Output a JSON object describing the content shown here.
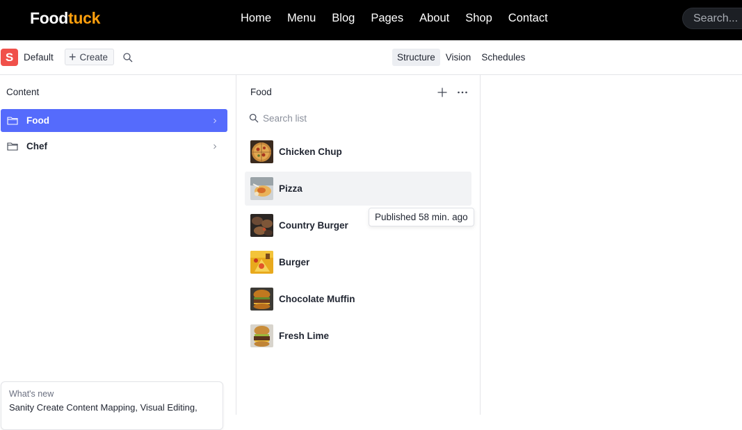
{
  "site": {
    "logo_part1": "Food",
    "logo_part2": "tuck",
    "nav": [
      "Home",
      "Menu",
      "Blog",
      "Pages",
      "About",
      "Shop",
      "Contact"
    ],
    "search_placeholder": "Search..."
  },
  "studio": {
    "workspace_initial": "S",
    "workspace_name": "Default",
    "create_label": "Create",
    "tools": [
      "Structure",
      "Vision",
      "Schedules"
    ],
    "active_tool": "Structure"
  },
  "content_pane": {
    "title": "Content",
    "items": [
      {
        "label": "Food",
        "selected": true
      },
      {
        "label": "Chef",
        "selected": false
      }
    ]
  },
  "whats_new": {
    "title": "What's new",
    "text": "Sanity Create Content Mapping, Visual Editing,"
  },
  "food_pane": {
    "title": "Food",
    "search_placeholder": "Search list",
    "documents": [
      {
        "title": "Chicken Chup"
      },
      {
        "title": "Pizza"
      },
      {
        "title": "Country Burger"
      },
      {
        "title": "Burger"
      },
      {
        "title": "Chocolate Muffin"
      },
      {
        "title": "Fresh Lime"
      }
    ],
    "tooltip": "Published 58 min. ago"
  },
  "colors": {
    "brand_accent": "#ff9f0d",
    "selection": "#556bfc",
    "workspace_logo": "#f0504a"
  }
}
